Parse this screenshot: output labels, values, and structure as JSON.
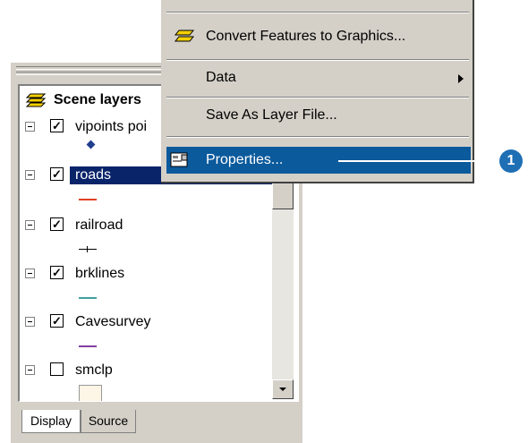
{
  "toc": {
    "title": "Scene layers",
    "layers": [
      {
        "name": "vipoints poi",
        "checked": true,
        "selected": false
      },
      {
        "name": "roads",
        "checked": true,
        "selected": true
      },
      {
        "name": "railroad",
        "checked": true,
        "selected": false
      },
      {
        "name": "brklines",
        "checked": true,
        "selected": false
      },
      {
        "name": "Cavesurvey",
        "checked": true,
        "selected": false
      },
      {
        "name": "smclp",
        "checked": false,
        "selected": false
      }
    ],
    "tabs": {
      "display": "Display",
      "source": "Source"
    }
  },
  "menu": {
    "items": {
      "convert": "Convert Features to Graphics...",
      "data": "Data",
      "save_layer": "Save As Layer File...",
      "properties": "Properties..."
    }
  },
  "callout": {
    "number": "1"
  },
  "colors": {
    "selection": "#0a246a",
    "menu_highlight": "#0a5a9c",
    "roads": "#e04020",
    "brklines": "#40a0a0",
    "cavesurvey": "#8040a0",
    "callout": "#1f6fb5"
  },
  "icons": [
    "layers-icon",
    "submenu-arrow-icon",
    "properties-icon",
    "scroll-down-arrow-icon",
    "convert-graphics-icon"
  ]
}
